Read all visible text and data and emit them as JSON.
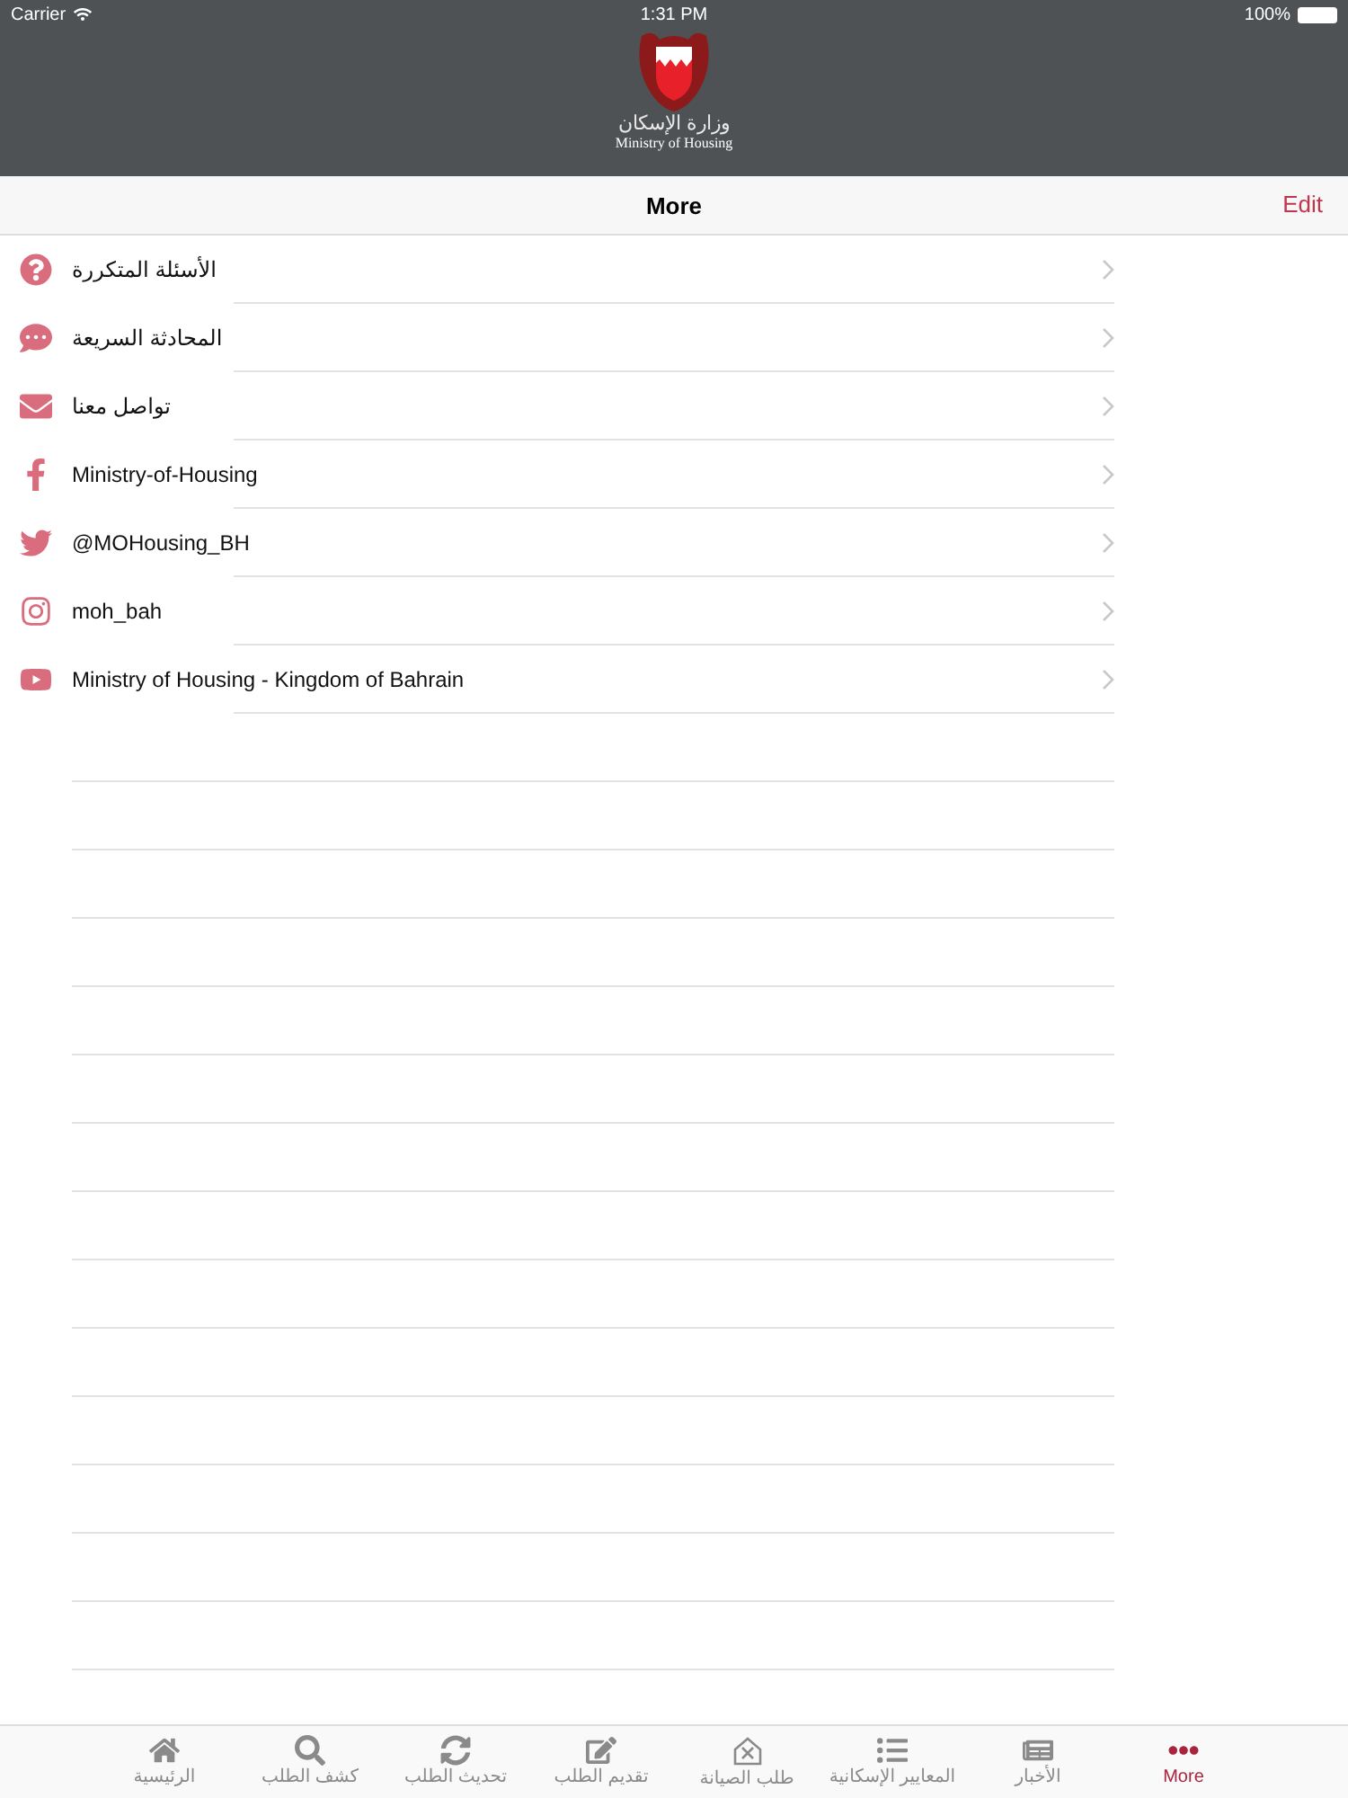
{
  "status_bar": {
    "carrier": "Carrier",
    "time": "1:31 PM",
    "battery": "100%"
  },
  "header": {
    "logo_arabic": "وزارة الإسكان",
    "logo_english": "Ministry of Housing"
  },
  "nav_bar": {
    "title": "More",
    "edit": "Edit"
  },
  "items": [
    {
      "label": "الأسئلة المتكررة"
    },
    {
      "label": "المحادثة السريعة"
    },
    {
      "label": "تواصل معنا"
    },
    {
      "label": "Ministry-of-Housing"
    },
    {
      "label": "@MOHousing_BH"
    },
    {
      "label": "moh_bah"
    },
    {
      "label": "Ministry of Housing - Kingdom of Bahrain"
    }
  ],
  "tabs": [
    {
      "label": "More",
      "selected": true
    },
    {
      "label": "الأخبار",
      "selected": false
    },
    {
      "label": "المعايير الإسكانية",
      "selected": false
    },
    {
      "label": "طلب الصيانة",
      "selected": false
    },
    {
      "label": "تقديم الطلب",
      "selected": false
    },
    {
      "label": "تحديث الطلب",
      "selected": false
    },
    {
      "label": "كشف الطلب",
      "selected": false
    },
    {
      "label": "الرئيسية",
      "selected": false
    }
  ]
}
